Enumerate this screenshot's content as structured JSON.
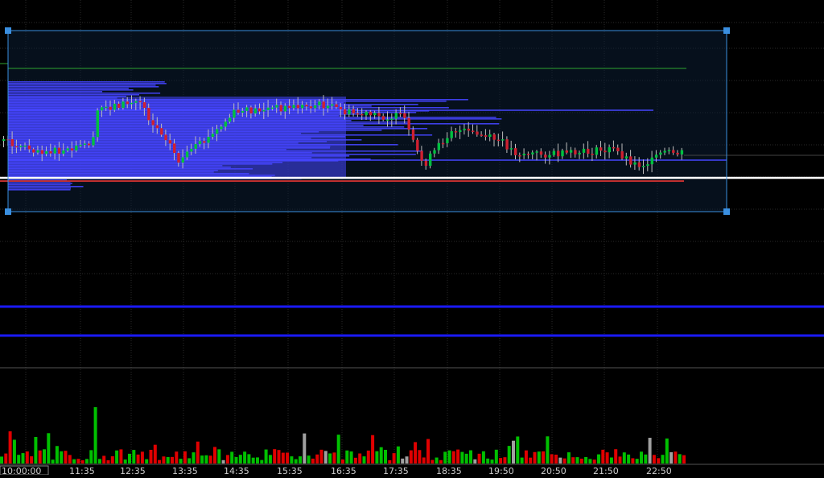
{
  "chart_data": {
    "type": "candlestick",
    "title": "",
    "xlabel": "",
    "ylabel": "",
    "x_ticks": [
      "10:00:00",
      "11:35",
      "12:35",
      "13:35",
      "14:35",
      "15:35",
      "16:35",
      "17:35",
      "18:35",
      "19:50",
      "20:50",
      "21:50",
      "22:50"
    ],
    "last_price_label": "",
    "grid": true,
    "volume_colors": [
      "#e00000",
      "#00c000",
      "#a0a0a0"
    ],
    "colors": {
      "background": "#000000",
      "grid": "#2a2a2a",
      "up": "#00c040",
      "down": "#d02030",
      "volume_profile": "#4545ff",
      "selection": "#3a8fe0",
      "indicator_lines": "#1a1aff",
      "level_white": "#ffffff",
      "level_green": "#2fa32f",
      "level_red": "#c03030"
    }
  }
}
